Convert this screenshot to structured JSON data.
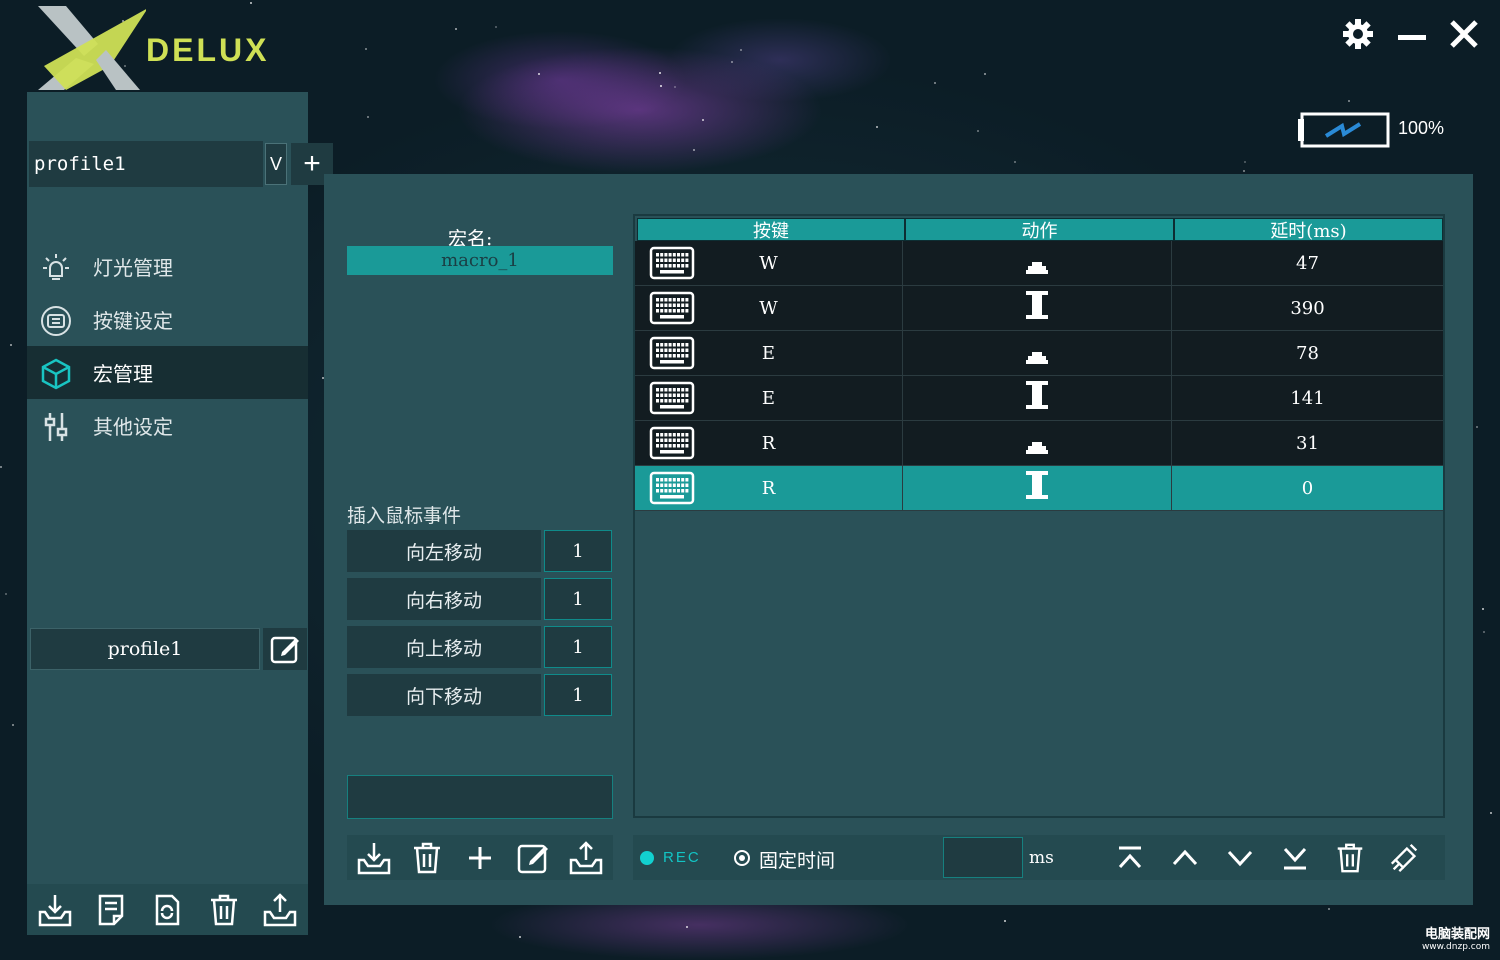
{
  "app": {
    "brand": "DELUX",
    "accent_color": "#1a9a98",
    "logo_color": "#cfe055"
  },
  "window_controls": {
    "settings_icon": "gear-icon",
    "minimize_icon": "minimize-icon",
    "close_icon": "close-icon"
  },
  "battery": {
    "percent_label": "100%",
    "level": 1.0,
    "charging": true
  },
  "sidebar": {
    "profile_select": {
      "value": "profile1",
      "dropdown_label": "V",
      "add_label": "+"
    },
    "nav": [
      {
        "label": "灯光管理",
        "icon": "light-bulb-icon",
        "active": false
      },
      {
        "label": "按键设定",
        "icon": "keyboard-key-icon",
        "active": false
      },
      {
        "label": "宏管理",
        "icon": "cube-icon",
        "active": true
      },
      {
        "label": "其他设定",
        "icon": "sliders-icon",
        "active": false
      }
    ],
    "profile_name": "profile1",
    "bottom_tools": [
      "import-icon",
      "save-file-icon",
      "reset-file-icon",
      "trash-icon",
      "export-icon"
    ]
  },
  "macro": {
    "name_label": "宏名:",
    "name_value": "macro_1",
    "insert_mouse_label": "插入鼠标事件",
    "mouse_moves": [
      {
        "label": "向左移动",
        "value": "1"
      },
      {
        "label": "向右移动",
        "value": "1"
      },
      {
        "label": "向上移动",
        "value": "1"
      },
      {
        "label": "向下移动",
        "value": "1"
      }
    ],
    "tools": [
      "import-icon",
      "trash-icon",
      "plus-icon",
      "edit-icon",
      "export-icon"
    ]
  },
  "events_table": {
    "headers": [
      "按键",
      "动作",
      "延时(ms)"
    ],
    "rows": [
      {
        "key": "W",
        "action": "press",
        "delay": "47",
        "selected": false
      },
      {
        "key": "W",
        "action": "release",
        "delay": "390",
        "selected": false
      },
      {
        "key": "E",
        "action": "press",
        "delay": "78",
        "selected": false
      },
      {
        "key": "E",
        "action": "release",
        "delay": "141",
        "selected": false
      },
      {
        "key": "R",
        "action": "press",
        "delay": "31",
        "selected": false
      },
      {
        "key": "R",
        "action": "release",
        "delay": "0",
        "selected": true
      }
    ]
  },
  "record_bar": {
    "rec_label": "REC",
    "fixed_time_label": "固定时间",
    "ms_value": "",
    "ms_label": "ms",
    "tools": [
      "move-top-icon",
      "move-up-icon",
      "move-down-icon",
      "move-bottom-icon",
      "trash-icon",
      "clear-icon"
    ]
  },
  "watermark": {
    "line1": "电脑装配网",
    "line2": "www.dnzp.com"
  }
}
